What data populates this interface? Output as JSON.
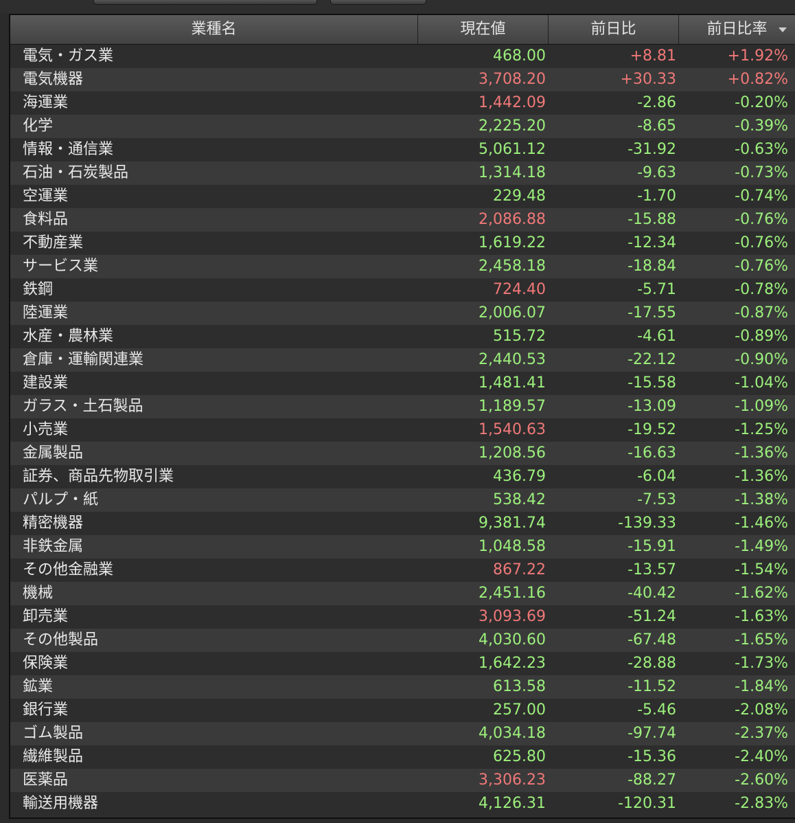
{
  "colors": {
    "positive": "#f07878",
    "negative": "#9cf07c",
    "text": "#e8e8e8"
  },
  "header": {
    "col_name": "業種名",
    "col_price": "現在値",
    "col_change": "前日比",
    "col_change_pct": "前日比率",
    "sort_icon": "chevron-down-icon"
  },
  "rows": [
    {
      "name": "電気・ガス業",
      "price": "468.00",
      "price_trend": "down",
      "change": "+8.81",
      "change_pct": "+1.92%",
      "trend": "up"
    },
    {
      "name": "電気機器",
      "price": "3,708.20",
      "price_trend": "up",
      "change": "+30.33",
      "change_pct": "+0.82%",
      "trend": "up"
    },
    {
      "name": "海運業",
      "price": "1,442.09",
      "price_trend": "up",
      "change": "-2.86",
      "change_pct": "-0.20%",
      "trend": "down"
    },
    {
      "name": "化学",
      "price": "2,225.20",
      "price_trend": "down",
      "change": "-8.65",
      "change_pct": "-0.39%",
      "trend": "down"
    },
    {
      "name": "情報・通信業",
      "price": "5,061.12",
      "price_trend": "down",
      "change": "-31.92",
      "change_pct": "-0.63%",
      "trend": "down"
    },
    {
      "name": "石油・石炭製品",
      "price": "1,314.18",
      "price_trend": "down",
      "change": "-9.63",
      "change_pct": "-0.73%",
      "trend": "down"
    },
    {
      "name": "空運業",
      "price": "229.48",
      "price_trend": "down",
      "change": "-1.70",
      "change_pct": "-0.74%",
      "trend": "down"
    },
    {
      "name": "食料品",
      "price": "2,086.88",
      "price_trend": "up",
      "change": "-15.88",
      "change_pct": "-0.76%",
      "trend": "down"
    },
    {
      "name": "不動産業",
      "price": "1,619.22",
      "price_trend": "down",
      "change": "-12.34",
      "change_pct": "-0.76%",
      "trend": "down"
    },
    {
      "name": "サービス業",
      "price": "2,458.18",
      "price_trend": "down",
      "change": "-18.84",
      "change_pct": "-0.76%",
      "trend": "down"
    },
    {
      "name": "鉄鋼",
      "price": "724.40",
      "price_trend": "up",
      "change": "-5.71",
      "change_pct": "-0.78%",
      "trend": "down"
    },
    {
      "name": "陸運業",
      "price": "2,006.07",
      "price_trend": "down",
      "change": "-17.55",
      "change_pct": "-0.87%",
      "trend": "down"
    },
    {
      "name": "水産・農林業",
      "price": "515.72",
      "price_trend": "down",
      "change": "-4.61",
      "change_pct": "-0.89%",
      "trend": "down"
    },
    {
      "name": "倉庫・運輸関連業",
      "price": "2,440.53",
      "price_trend": "down",
      "change": "-22.12",
      "change_pct": "-0.90%",
      "trend": "down"
    },
    {
      "name": "建設業",
      "price": "1,481.41",
      "price_trend": "down",
      "change": "-15.58",
      "change_pct": "-1.04%",
      "trend": "down"
    },
    {
      "name": "ガラス・土石製品",
      "price": "1,189.57",
      "price_trend": "down",
      "change": "-13.09",
      "change_pct": "-1.09%",
      "trend": "down"
    },
    {
      "name": "小売業",
      "price": "1,540.63",
      "price_trend": "up",
      "change": "-19.52",
      "change_pct": "-1.25%",
      "trend": "down"
    },
    {
      "name": "金属製品",
      "price": "1,208.56",
      "price_trend": "down",
      "change": "-16.63",
      "change_pct": "-1.36%",
      "trend": "down"
    },
    {
      "name": "証券、商品先物取引業",
      "price": "436.79",
      "price_trend": "down",
      "change": "-6.04",
      "change_pct": "-1.36%",
      "trend": "down"
    },
    {
      "name": "パルプ・紙",
      "price": "538.42",
      "price_trend": "down",
      "change": "-7.53",
      "change_pct": "-1.38%",
      "trend": "down"
    },
    {
      "name": "精密機器",
      "price": "9,381.74",
      "price_trend": "down",
      "change": "-139.33",
      "change_pct": "-1.46%",
      "trend": "down"
    },
    {
      "name": "非鉄金属",
      "price": "1,048.58",
      "price_trend": "down",
      "change": "-15.91",
      "change_pct": "-1.49%",
      "trend": "down"
    },
    {
      "name": "その他金融業",
      "price": "867.22",
      "price_trend": "up",
      "change": "-13.57",
      "change_pct": "-1.54%",
      "trend": "down"
    },
    {
      "name": "機械",
      "price": "2,451.16",
      "price_trend": "down",
      "change": "-40.42",
      "change_pct": "-1.62%",
      "trend": "down"
    },
    {
      "name": "卸売業",
      "price": "3,093.69",
      "price_trend": "up",
      "change": "-51.24",
      "change_pct": "-1.63%",
      "trend": "down"
    },
    {
      "name": "その他製品",
      "price": "4,030.60",
      "price_trend": "down",
      "change": "-67.48",
      "change_pct": "-1.65%",
      "trend": "down"
    },
    {
      "name": "保険業",
      "price": "1,642.23",
      "price_trend": "down",
      "change": "-28.88",
      "change_pct": "-1.73%",
      "trend": "down"
    },
    {
      "name": "鉱業",
      "price": "613.58",
      "price_trend": "down",
      "change": "-11.52",
      "change_pct": "-1.84%",
      "trend": "down"
    },
    {
      "name": "銀行業",
      "price": "257.00",
      "price_trend": "down",
      "change": "-5.46",
      "change_pct": "-2.08%",
      "trend": "down"
    },
    {
      "name": "ゴム製品",
      "price": "4,034.18",
      "price_trend": "down",
      "change": "-97.74",
      "change_pct": "-2.37%",
      "trend": "down"
    },
    {
      "name": "繊維製品",
      "price": "625.80",
      "price_trend": "down",
      "change": "-15.36",
      "change_pct": "-2.40%",
      "trend": "down"
    },
    {
      "name": "医薬品",
      "price": "3,306.23",
      "price_trend": "up",
      "change": "-88.27",
      "change_pct": "-2.60%",
      "trend": "down"
    },
    {
      "name": "輸送用機器",
      "price": "4,126.31",
      "price_trend": "down",
      "change": "-120.31",
      "change_pct": "-2.83%",
      "trend": "down"
    }
  ]
}
